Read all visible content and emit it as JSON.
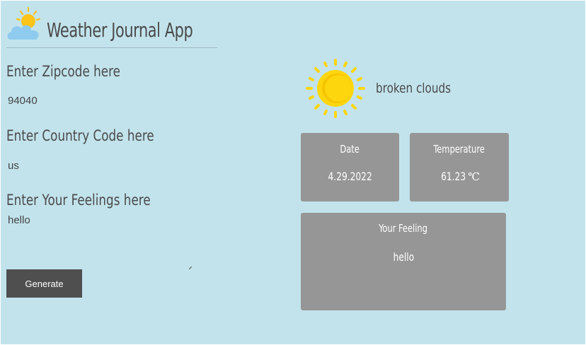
{
  "header": {
    "title": "Weather Journal App",
    "logo_icon": "partly-cloudy-icon"
  },
  "form": {
    "zip_label": "Enter Zipcode here",
    "zip_value": "94040",
    "country_label": "Enter Country Code here",
    "country_value": "us",
    "feelings_label": "Enter Your Feelings here",
    "feelings_value": "hello",
    "generate_label": "Generate"
  },
  "weather": {
    "icon": "sun-icon",
    "description": "broken clouds",
    "date_label": "Date",
    "date_value": "4.29.2022",
    "temp_label": "Temperature",
    "temp_value": "61.23",
    "temp_unit": "℃",
    "feeling_label": "Your Feeling",
    "feeling_value": "hello"
  },
  "colors": {
    "background": "#c2e3ec",
    "card": "#969696",
    "button": "#4f4f4f",
    "sun": "#fdd60e",
    "text": "#4a4a4a"
  }
}
